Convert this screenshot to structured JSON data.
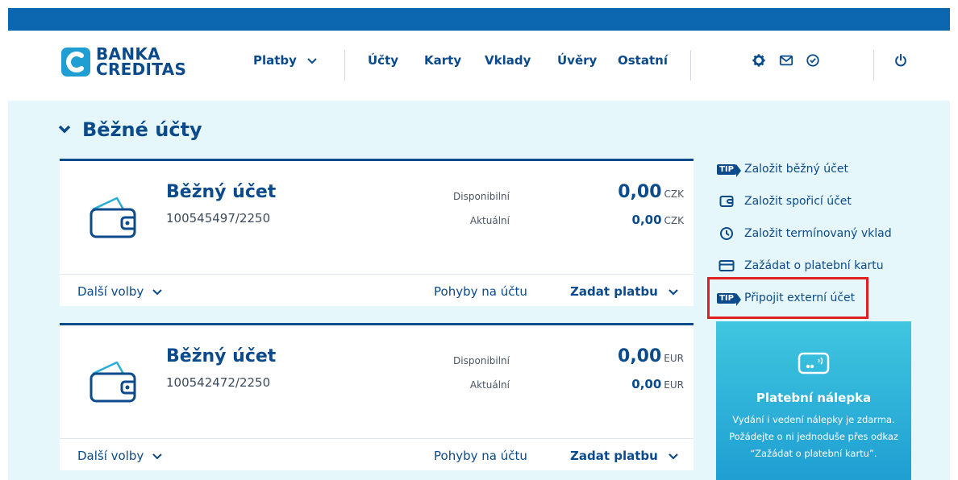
{
  "brand": {
    "line1": "BANKA",
    "line2": "CREDITAS"
  },
  "nav": {
    "items": [
      {
        "label": "Platby"
      },
      {
        "label": "Účty"
      },
      {
        "label": "Karty"
      },
      {
        "label": "Vklady"
      },
      {
        "label": "Úvěry"
      },
      {
        "label": "Ostatní"
      }
    ],
    "icons": [
      "gear-icon",
      "mail-icon",
      "check-circle-icon",
      "power-icon"
    ]
  },
  "section": {
    "title": "Běžné účty"
  },
  "accounts": [
    {
      "name": "Běžný účet",
      "number": "100545497/2250",
      "available_label": "Disponibilní",
      "available_value": "0,00",
      "current_label": "Aktuální",
      "current_value": "0,00",
      "currency": "CZK",
      "more_options": "Další volby",
      "movements": "Pohyby na účtu",
      "make_payment": "Zadat platbu"
    },
    {
      "name": "Běžný účet",
      "number": "100542472/2250",
      "available_label": "Disponibilní",
      "available_value": "0,00",
      "current_label": "Aktuální",
      "current_value": "0,00",
      "currency": "EUR",
      "more_options": "Další volby",
      "movements": "Pohyby na účtu",
      "make_payment": "Zadat platbu"
    }
  ],
  "sidebar": {
    "tip_badge": "TIP",
    "links": [
      {
        "label": "Založit běžný účet",
        "icon": "tip-badge"
      },
      {
        "label": "Založit spořicí účet",
        "icon": "wallet-icon"
      },
      {
        "label": "Založit termínovaný vklad",
        "icon": "clock-icon"
      },
      {
        "label": "Zažádat o platební kartu",
        "icon": "card-icon"
      },
      {
        "label": "Připojit externí účet",
        "icon": "tip-badge"
      }
    ]
  },
  "promo": {
    "title": "Platební nálepka",
    "text": "Vydání i vedení nálepky je zdarma. Požádejte o ni jednoduše přes odkaz “Zažádat o platební kartu”."
  },
  "colors": {
    "brand_blue": "#0b4a8b",
    "top_bar": "#0d66b0",
    "page_bg": "#e5f7fb",
    "highlight": "#e02020",
    "promo": "#2fb6dc"
  }
}
